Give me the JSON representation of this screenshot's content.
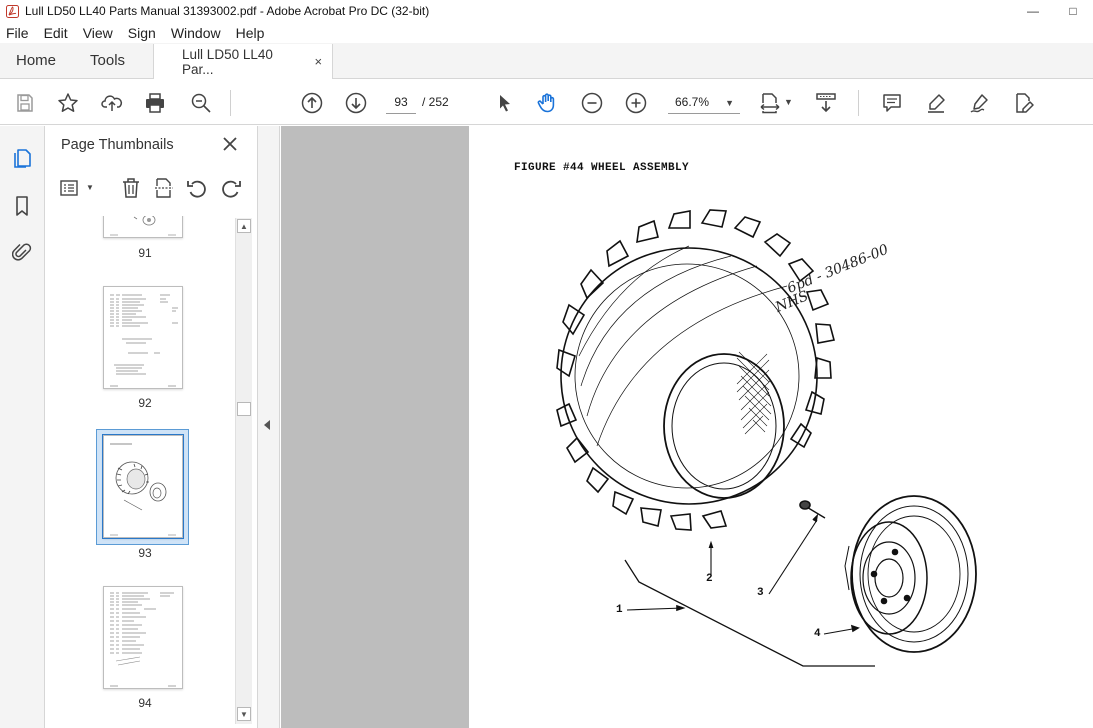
{
  "window": {
    "title": "Lull LD50 LL40 Parts Manual 31393002.pdf - Adobe Acrobat Pro DC (32-bit)"
  },
  "menu": [
    "File",
    "Edit",
    "View",
    "Sign",
    "Window",
    "Help"
  ],
  "tabs": {
    "home": "Home",
    "tools": "Tools",
    "document": "Lull LD50 LL40 Par...",
    "close": "×"
  },
  "toolbar": {
    "current_page": "93",
    "total_pages": "/ 252",
    "zoom": "66.7%",
    "icons": [
      "save-icon",
      "bookmark-star-icon",
      "share-upload-icon",
      "print-icon",
      "find-zoom-icon",
      "prev-page-icon",
      "next-page-icon",
      "select-cursor-icon",
      "hand-tool-icon",
      "zoom-out-icon",
      "zoom-in-icon",
      "page-fit-icon",
      "scroll-mode-icon",
      "comment-icon",
      "highlight-icon",
      "sign-icon",
      "edit-pdf-icon"
    ]
  },
  "panel": {
    "title": "Page Thumbnails",
    "thumbnails": [
      {
        "label": "91"
      },
      {
        "label": "92"
      },
      {
        "label": "93",
        "selected": true
      },
      {
        "label": "94"
      }
    ]
  },
  "page": {
    "figure_title": "FIGURE #44  WHEEL ASSEMBLY",
    "handwritten": [
      "NHS",
      "6pd - 30486-00"
    ],
    "callouts": [
      "1",
      "2",
      "3",
      "4"
    ]
  },
  "colors": {
    "selection": "#cfe3f7",
    "selection_border": "#5b9bd5",
    "doc_background": "#bdbdbd",
    "chrome": "#f4f4f4"
  }
}
